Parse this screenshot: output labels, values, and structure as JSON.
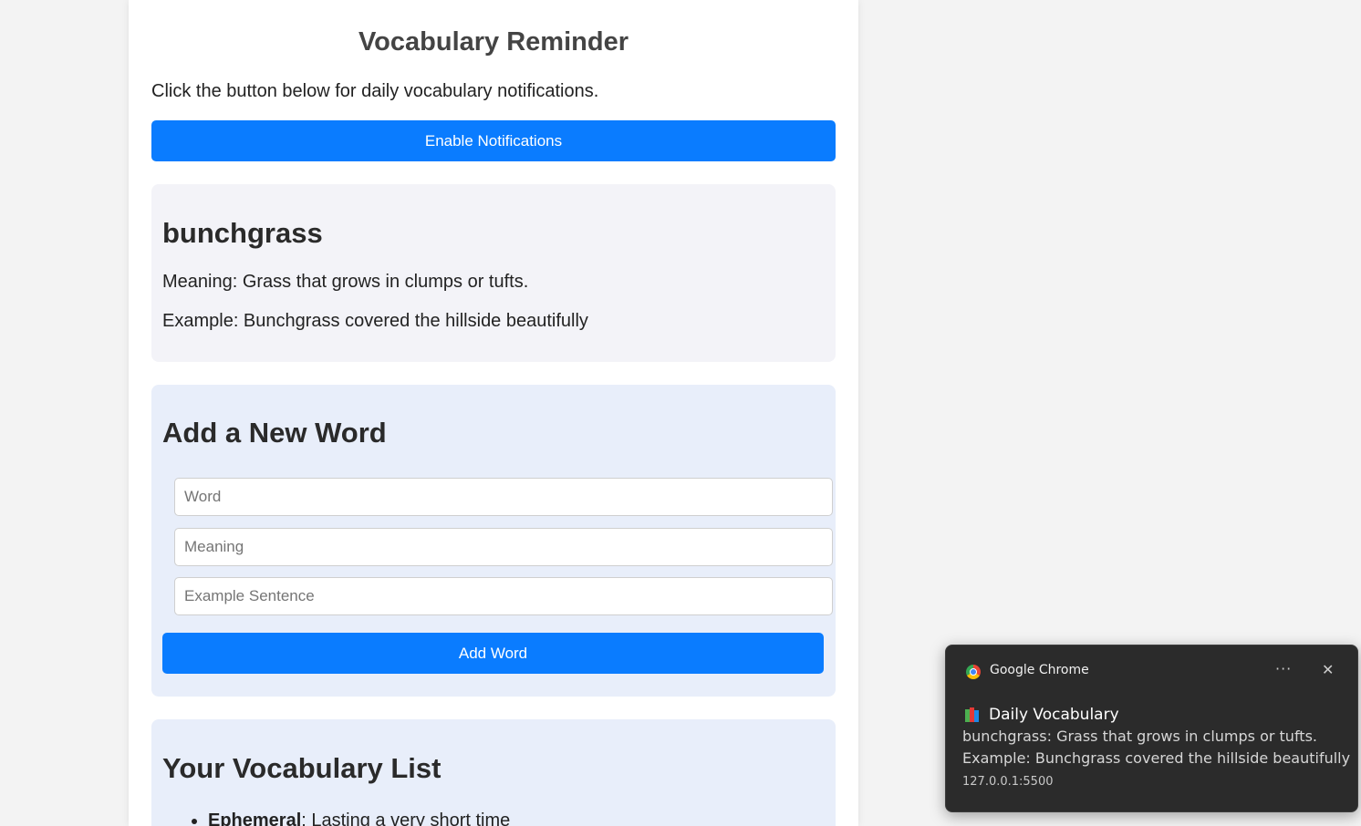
{
  "app": {
    "title": "Vocabulary Reminder",
    "intro": "Click the button below for daily vocabulary notifications.",
    "enable_button": "Enable Notifications"
  },
  "daily_word": {
    "word": "bunchgrass",
    "meaning": "Meaning: Grass that grows in clumps or tufts.",
    "example": "Example: Bunchgrass covered the hillside beautifully"
  },
  "add_form": {
    "title": "Add a New Word",
    "word_placeholder": "Word",
    "meaning_placeholder": "Meaning",
    "example_placeholder": "Example Sentence",
    "submit_label": "Add Word"
  },
  "vocab_list": {
    "title": "Your Vocabulary List",
    "items": [
      {
        "word": "Ephemeral",
        "definition": ": Lasting a very short time"
      }
    ]
  },
  "notification": {
    "app_name": "Google Chrome",
    "more_icon": "ellipsis-icon",
    "close_icon": "close-icon",
    "title": "Daily Vocabulary",
    "line1": "bunchgrass: Grass that grows in clumps or tufts.",
    "line2": "Example: Bunchgrass covered the hillside beautifully",
    "source": "127.0.0.1:5500"
  },
  "colors": {
    "accent": "#0a7cff",
    "toast_bg": "#2b2b2b"
  }
}
